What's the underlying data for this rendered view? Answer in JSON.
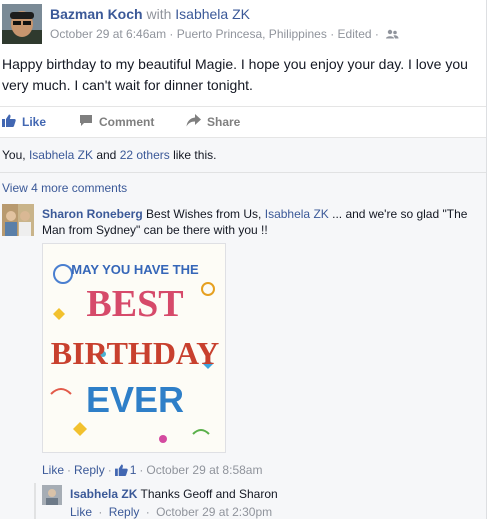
{
  "post": {
    "author": "Bazman Koch",
    "with_prefix": "with",
    "tagged": "Isabhela ZK",
    "date": "October 29 at 6:46am",
    "location": "Puerto Princesa, Philippines",
    "edited": "Edited",
    "text": "Happy birthday to my beautiful Magie. I hope you enjoy your day. I love you very much. I can't wait for dinner tonight.",
    "dot": "·"
  },
  "actions": {
    "like": "Like",
    "comment": "Comment",
    "share": "Share"
  },
  "likes": {
    "prefix": "You,",
    "person": "Isabhela ZK",
    "and": "and",
    "others": "22 others",
    "suffix": "like this."
  },
  "view_more": "View 4 more comments",
  "comments": [
    {
      "name": "Sharon Roneberg",
      "text_before": "Best Wishes from Us,",
      "mention": "Isabhela ZK",
      "text_after": "... and we're so glad \"The Man from Sydney\" can be there with you !!",
      "image_alt": "May you have the BEST BIRTHDAY EVER",
      "card": {
        "line1": "MAY YOU HAVE THE",
        "line2": "BEST",
        "line3": "BIRTHDAY",
        "line4": "EVER"
      },
      "like_label": "Like",
      "reply_label": "Reply",
      "like_count": "1",
      "date": "October 29 at 8:58am"
    }
  ],
  "reply": {
    "name": "Isabhela ZK",
    "text": "Thanks Geoff and Sharon",
    "like_label": "Like",
    "reply_label": "Reply",
    "date": "October 29 at 2:30pm"
  },
  "colors": {
    "link": "#3b5998",
    "meta": "#90949c",
    "action_gray": "#7f7f7f",
    "ufi_bg": "#f6f7f9"
  },
  "icons": {
    "audience": "friends-icon",
    "like": "thumbs-up-icon",
    "comment": "comment-bubble-icon",
    "share": "share-arrow-icon"
  }
}
